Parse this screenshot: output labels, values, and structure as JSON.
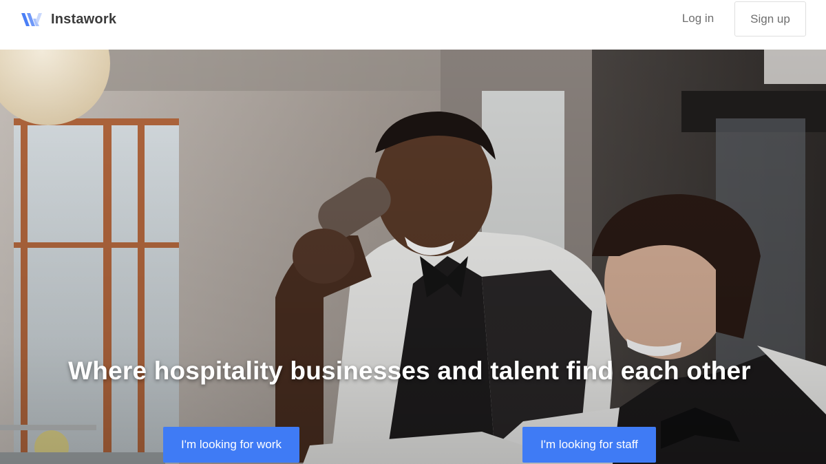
{
  "header": {
    "brand": "Instawork",
    "login_label": "Log in",
    "signup_label": "Sign up",
    "logo_icon": "instawork-w-logo"
  },
  "hero": {
    "title": "Where hospitality businesses and talent find each other",
    "cta_work_label": "I'm looking for work",
    "cta_staff_label": "I'm looking for staff",
    "photo_alt": "Two smiling bartenders in black vests and bow ties, one shaking a cocktail shaker"
  },
  "colors": {
    "accent": "#3f7bf5",
    "logo_blue": "#4a7ff6",
    "logo_light": "#a9c2fb",
    "text_dark": "#3b3b3b",
    "text_muted": "#6e6e6e"
  }
}
